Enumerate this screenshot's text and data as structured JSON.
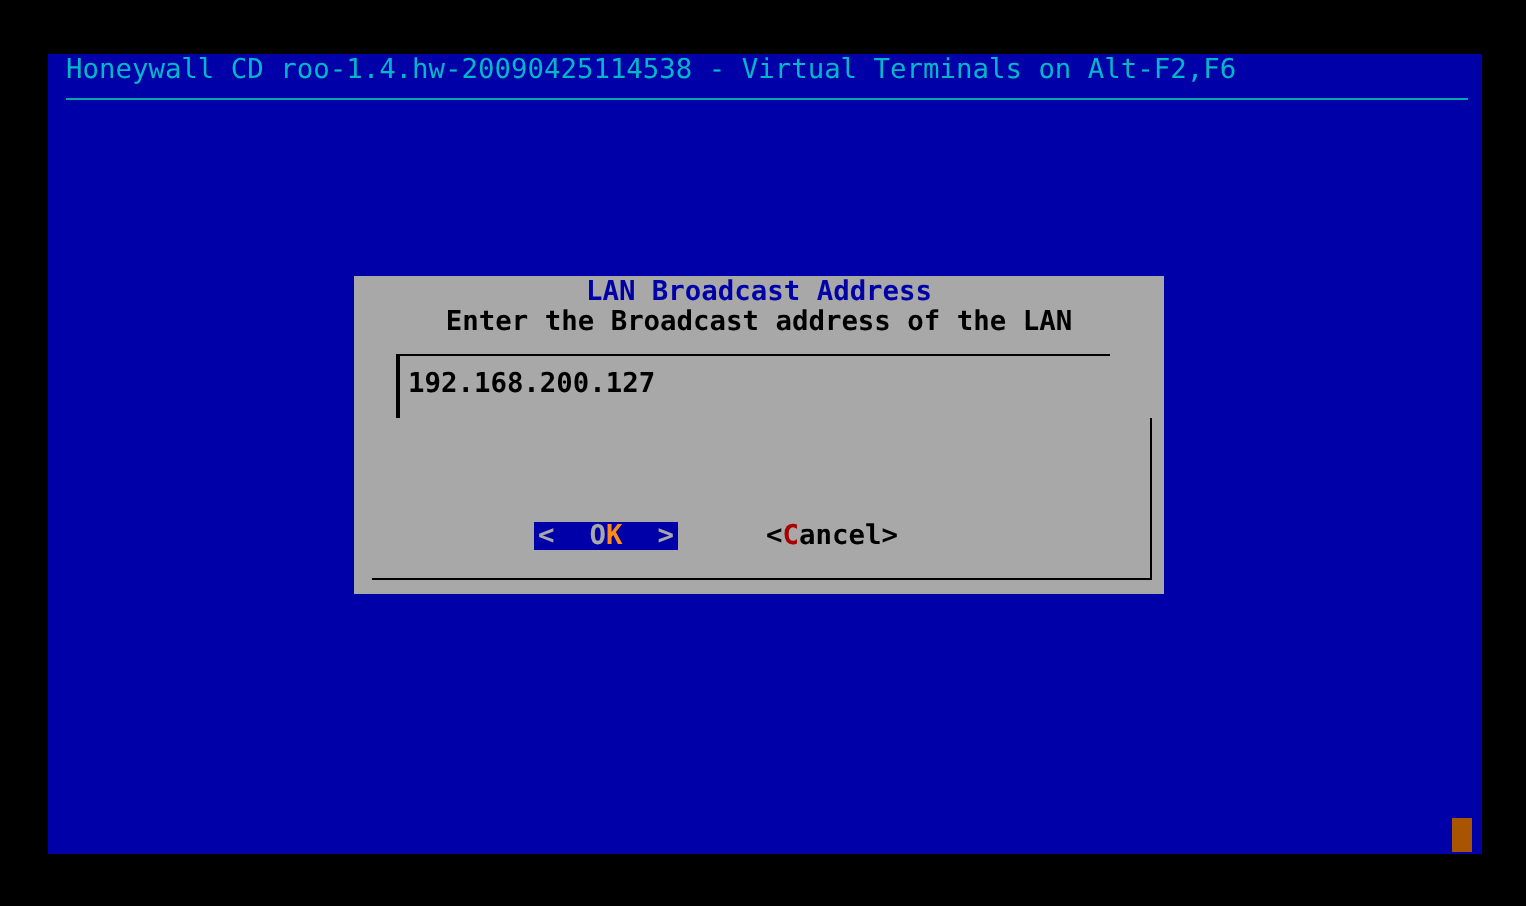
{
  "header": {
    "title": "Honeywall CD roo-1.4.hw-20090425114538 - Virtual Terminals on Alt-F2,F6"
  },
  "dialog": {
    "title": "LAN Broadcast Address",
    "prompt": "Enter the Broadcast address of the LAN",
    "input": {
      "value": "192.168.200.127"
    },
    "buttons": [
      {
        "open": "<",
        "before": "O",
        "hotkey": "K",
        "close": ">",
        "selected": true
      },
      {
        "open": "<",
        "hotkey": "C",
        "after": "ancel",
        "close": ">",
        "selected": false
      }
    ]
  }
}
